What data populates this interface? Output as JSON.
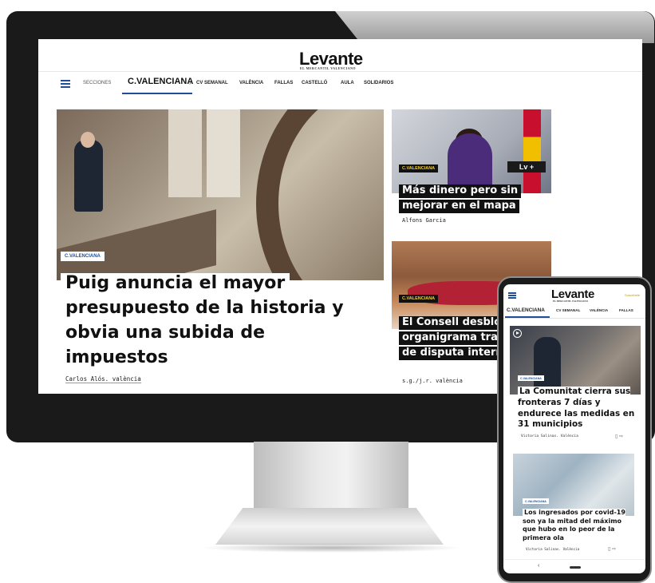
{
  "desktop": {
    "logo": "Levante",
    "logo_sub": "EL MERCANTIL VALENCIANO",
    "nav": {
      "secciones": "SECCIONES",
      "active": "C.VALENCIANA",
      "chevron": "›",
      "items": [
        "CV SEMANAL",
        "VALÈNCIA",
        "FALLAS",
        "CASTELLÓ",
        "AULA",
        "SOLIDARIOS"
      ]
    },
    "main_story": {
      "tag": "C.VALENCIANA",
      "title": "Puig anuncia el mayor presupuesto de la historia y obvia una subida de impuestos",
      "byline": "Carlos Alós. valència"
    },
    "side_story_1": {
      "tag": "C.VALENCIANA",
      "badge": "Lv +",
      "title": "Más dinero pero sin mejorar en el mapa",
      "byline": "Alfons Garcia"
    },
    "side_story_2": {
      "tag": "C.VALENCIANA",
      "title": "El Consell desbloq organigrama tras medio de disputa internas",
      "byline": "s.g./j.r. valència"
    }
  },
  "mobile": {
    "logo": "Levante",
    "logo_sub": "EL MERCANTIL VALENCIANO",
    "login": "Suscríbete",
    "nav": {
      "active": "C.VALENCIANA",
      "items": [
        "CV SEMANAL",
        "VALÈNCIA",
        "FALLAS"
      ]
    },
    "story_1": {
      "tag": "C.VALENCIANA",
      "title": "La Comunitat cierra sus fronteras 7 días y endurece las medidas en 31 municipios",
      "byline": "Victoria Salinas. València"
    },
    "story_2": {
      "tag": "C.VALENCIANA",
      "title": "Los ingresados por covid-19 son ya la mitad del máximo que hubo en lo peor de la primera ola",
      "byline": "Victoria Salinas. València"
    },
    "system_bar": {
      "back": "‹"
    }
  },
  "colors": {
    "accent_blue": "#1e4f98",
    "tag_yellow": "#f3d03e",
    "bezel": "#1a1a1a"
  }
}
